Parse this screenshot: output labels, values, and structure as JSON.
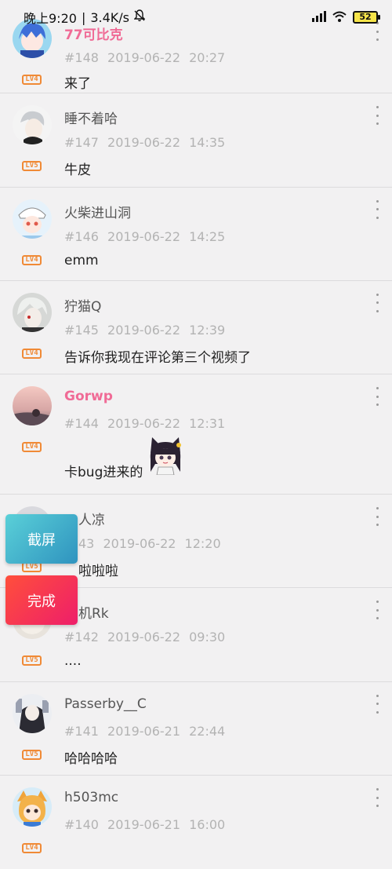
{
  "status_bar": {
    "time": "晚上9:20",
    "separator": "|",
    "speed": "3.4K/s",
    "battery": "52",
    "icons": [
      "bell-off-icon",
      "signal-icon",
      "wifi-icon",
      "battery-icon"
    ]
  },
  "comments": [
    {
      "username": "77可比克",
      "vip": true,
      "floor": "#148",
      "datetime": "2019-06-22 20:27",
      "content": "来了",
      "level": "LV4"
    },
    {
      "username": "睡不着哈",
      "vip": false,
      "floor": "#147",
      "datetime": "2019-06-22 14:35",
      "content": "牛皮",
      "level": "LV5"
    },
    {
      "username": "火柴进山洞",
      "vip": false,
      "floor": "#146",
      "datetime": "2019-06-22 14:25",
      "content": "emm",
      "level": "LV4"
    },
    {
      "username": "狞猫Q",
      "vip": false,
      "floor": "#145",
      "datetime": "2019-06-22 12:39",
      "content": "告诉你我现在评论第三个视频了",
      "level": "LV4"
    },
    {
      "username": "Gorwp",
      "vip": true,
      "floor": "#144",
      "datetime": "2019-06-22 12:31",
      "content": "卡bug进来的",
      "level": "LV4",
      "sticker": "anime-girl-sticker"
    },
    {
      "username": "人凉",
      "vip": false,
      "floor": "43",
      "datetime": "2019-06-22 12:20",
      "content": "啦啦啦",
      "level": "LV5"
    },
    {
      "username": "机Rk",
      "vip": false,
      "floor": "#142",
      "datetime": "2019-06-22 09:30",
      "content": "....",
      "level": "LV5"
    },
    {
      "username": "Passerby__C",
      "vip": false,
      "floor": "#141",
      "datetime": "2019-06-21 22:44",
      "content": "哈哈哈哈",
      "level": "LV5"
    },
    {
      "username": "h503mc",
      "vip": false,
      "floor": "#140",
      "datetime": "2019-06-21 16:00",
      "content": "",
      "level": "LV4"
    }
  ],
  "floating_buttons": {
    "screenshot": "截屏",
    "done": "完成"
  },
  "colors": {
    "vip_name": "#f06b96",
    "level_badge": "#f08a36",
    "screenshot_button": "#3fb3cc",
    "done_button": "#f5324f"
  }
}
